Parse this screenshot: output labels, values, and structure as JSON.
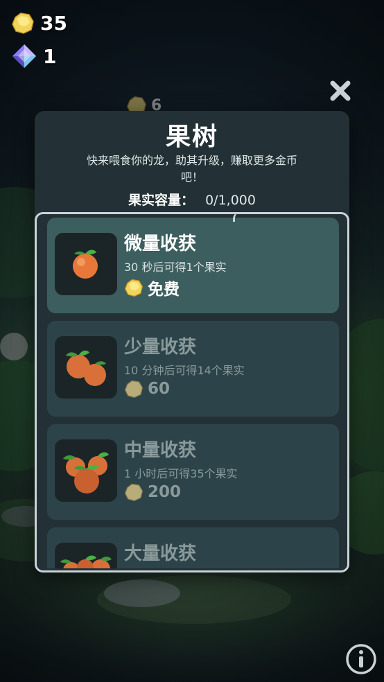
{
  "hud": {
    "gold_count": "35",
    "gem_count": "1",
    "floating_cost": "6"
  },
  "panel": {
    "title": "果树",
    "description": "快来喂食你的龙，助其升级，赚取更多金币吧！",
    "capacity_label": "果实容量：",
    "capacity_value": "0/1,000"
  },
  "harvests": [
    {
      "name": "微量收获",
      "detail": "30 秒后可得1个果实",
      "price": "免费",
      "active": true,
      "fruit_count": 1
    },
    {
      "name": "少量收获",
      "detail": "10 分钟后可得14个果实",
      "price": "60",
      "active": false,
      "fruit_count": 2
    },
    {
      "name": "中量收获",
      "detail": "1 小时后可得35个果实",
      "price": "200",
      "active": false,
      "fruit_count": 3
    },
    {
      "name": "大量收获",
      "detail": "",
      "price": "",
      "active": false,
      "fruit_count": 4
    }
  ],
  "icons": {
    "gold": "gold-nugget-icon",
    "gem": "gem-icon",
    "close": "close-icon",
    "info": "info-icon",
    "fruit": "fruit-icon"
  },
  "colors": {
    "panel_bg": "#233136",
    "card_bg": "#2c4449",
    "card_active_bg": "#3c5e5f",
    "fruit": "#e8783a",
    "leaf": "#3f9a3a",
    "gold": "#f3d45a"
  }
}
